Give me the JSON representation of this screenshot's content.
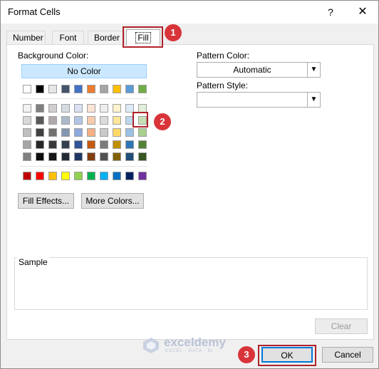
{
  "window": {
    "title": "Format Cells",
    "help_glyph": "?",
    "close_glyph": "✕"
  },
  "tabs": [
    {
      "label": "Number"
    },
    {
      "label": "Font"
    },
    {
      "label": "Border"
    },
    {
      "label": "Fill",
      "selected": true
    }
  ],
  "background": {
    "label": "Background Color:",
    "no_color": "No Color",
    "selected_swatch": "Green, Accent 6, Lighter 60%",
    "palette": {
      "theme_row": [
        "#ffffff",
        "#000000",
        "#e7e6e6",
        "#44546a",
        "#4472c4",
        "#ed7d31",
        "#a5a5a5",
        "#ffc000",
        "#5b9bd5",
        "#70ad47"
      ],
      "tint_rows": [
        [
          "#f2f2f2",
          "#7f7f7f",
          "#d0cece",
          "#d6dce4",
          "#d9e1f2",
          "#fce4d6",
          "#ededed",
          "#fff2cc",
          "#ddebf7",
          "#e2efda"
        ],
        [
          "#d9d9d9",
          "#595959",
          "#aeaaaa",
          "#acb9ca",
          "#b4c6e7",
          "#f8cbad",
          "#dbdbdb",
          "#ffe699",
          "#bdd7ee",
          "#c6e0b4"
        ],
        [
          "#bfbfbf",
          "#404040",
          "#757171",
          "#8497b0",
          "#8ea9db",
          "#f4b084",
          "#c9c9c9",
          "#ffd966",
          "#9bc2e6",
          "#a9d08e"
        ],
        [
          "#a6a6a6",
          "#262626",
          "#3a3838",
          "#333f4f",
          "#305496",
          "#c65911",
          "#7b7b7b",
          "#bf8f00",
          "#2f75b5",
          "#548235"
        ],
        [
          "#808080",
          "#0d0d0d",
          "#161616",
          "#222b35",
          "#203764",
          "#833c0c",
          "#525252",
          "#806000",
          "#1f4e78",
          "#375623"
        ]
      ],
      "standard_row": [
        "#c00000",
        "#ff0000",
        "#ffc000",
        "#ffff00",
        "#92d050",
        "#00b050",
        "#00b0f0",
        "#0070c0",
        "#002060",
        "#7030a0"
      ]
    }
  },
  "buttons": {
    "fill_effects": "Fill Effects...",
    "more_colors": "More Colors...",
    "clear": "Clear",
    "ok": "OK",
    "cancel": "Cancel"
  },
  "pattern": {
    "color_label": "Pattern Color:",
    "color_value": "Automatic",
    "style_label": "Pattern Style:",
    "style_value": ""
  },
  "sample": {
    "label": "Sample"
  },
  "markers": [
    "1",
    "2",
    "3"
  ],
  "watermark": {
    "name": "exceldemy",
    "tagline": "EXCEL · DATA · BI"
  }
}
